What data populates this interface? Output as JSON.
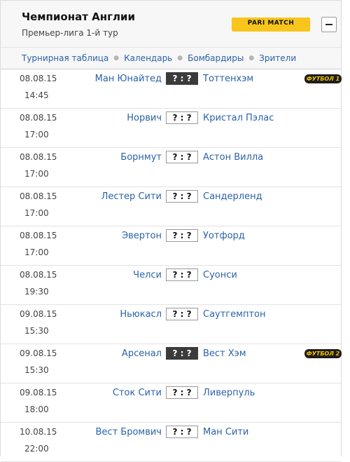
{
  "header": {
    "title": "Чемпионат Англии",
    "subtitle": "Премьер-лига 1-й тур",
    "sponsor_logo": "PARI MATCH"
  },
  "nav": {
    "items": [
      "Турнирная таблица",
      "Календарь",
      "Бомбардиры",
      "Зрители"
    ]
  },
  "matches": [
    {
      "date": "08.08.15",
      "time": "14:45",
      "home": "Ман Юнайтед",
      "score": "? : ?",
      "away": "Тоттенхэм",
      "tv": "ФУТБОЛ 1"
    },
    {
      "date": "08.08.15",
      "time": "17:00",
      "home": "Норвич",
      "score": "? : ?",
      "away": "Кристал Пэлас"
    },
    {
      "date": "08.08.15",
      "time": "17:00",
      "home": "Борнмут",
      "score": "? : ?",
      "away": "Астон Вилла"
    },
    {
      "date": "08.08.15",
      "time": "17:00",
      "home": "Лестер Сити",
      "score": "? : ?",
      "away": "Сандерленд"
    },
    {
      "date": "08.08.15",
      "time": "17:00",
      "home": "Эвертон",
      "score": "? : ?",
      "away": "Уотфорд"
    },
    {
      "date": "08.08.15",
      "time": "19:30",
      "home": "Челси",
      "score": "? : ?",
      "away": "Суонси"
    },
    {
      "date": "09.08.15",
      "time": "15:30",
      "home": "Ньюкасл",
      "score": "? : ?",
      "away": "Саутгемптон"
    },
    {
      "date": "09.08.15",
      "time": "15:30",
      "home": "Арсенал",
      "score": "? : ?",
      "away": "Вест Хэм",
      "tv": "ФУТБОЛ 2"
    },
    {
      "date": "09.08.15",
      "time": "18:00",
      "home": "Сток Сити",
      "score": "? : ?",
      "away": "Ливерпуль"
    },
    {
      "date": "10.08.15",
      "time": "22:00",
      "home": "Вест Бромвич",
      "score": "? : ?",
      "away": "Ман Сити"
    }
  ]
}
